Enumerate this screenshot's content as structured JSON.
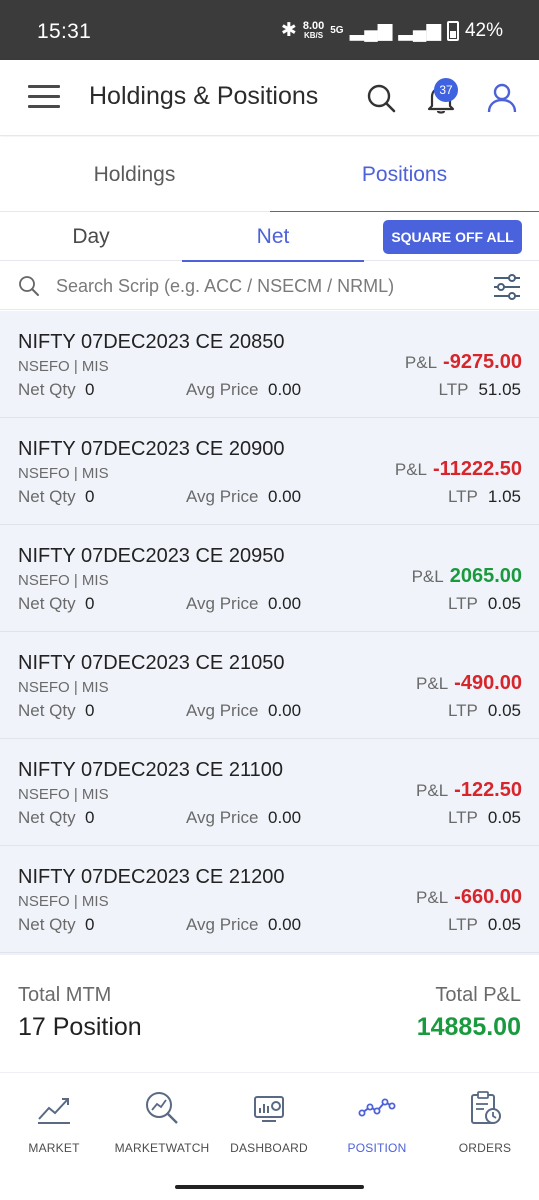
{
  "status_bar": {
    "time": "15:31",
    "speed": "8.00",
    "speed_unit": "KB/S",
    "net": "5G",
    "battery": "42%"
  },
  "header": {
    "title": "Holdings & Positions",
    "notification_count": "37"
  },
  "tabs": [
    {
      "label": "Holdings"
    },
    {
      "label": "Positions"
    }
  ],
  "subtabs": [
    {
      "label": "Day"
    },
    {
      "label": "Net"
    }
  ],
  "square_off_label": "SQUARE OFF ALL",
  "search": {
    "placeholder": "Search Scrip (e.g. ACC / NSECM / NRML)"
  },
  "labels": {
    "net_qty": "Net Qty",
    "avg_price": "Avg Price",
    "pnl": "P&L",
    "ltp": "LTP"
  },
  "positions": [
    {
      "scrip": "NIFTY 07DEC2023 CE 20850",
      "exchange": "NSEFO | MIS",
      "net_qty": "0",
      "avg_price": "0.00",
      "pnl": "-9275.00",
      "ltp": "51.05"
    },
    {
      "scrip": "NIFTY 07DEC2023 CE 20900",
      "exchange": "NSEFO | MIS",
      "net_qty": "0",
      "avg_price": "0.00",
      "pnl": "-11222.50",
      "ltp": "1.05"
    },
    {
      "scrip": "NIFTY 07DEC2023 CE 20950",
      "exchange": "NSEFO | MIS",
      "net_qty": "0",
      "avg_price": "0.00",
      "pnl": "2065.00",
      "ltp": "0.05"
    },
    {
      "scrip": "NIFTY 07DEC2023 CE 21050",
      "exchange": "NSEFO | MIS",
      "net_qty": "0",
      "avg_price": "0.00",
      "pnl": "-490.00",
      "ltp": "0.05"
    },
    {
      "scrip": "NIFTY 07DEC2023 CE 21100",
      "exchange": "NSEFO | MIS",
      "net_qty": "0",
      "avg_price": "0.00",
      "pnl": "-122.50",
      "ltp": "0.05"
    },
    {
      "scrip": "NIFTY 07DEC2023 CE 21200",
      "exchange": "NSEFO | MIS",
      "net_qty": "0",
      "avg_price": "0.00",
      "pnl": "-660.00",
      "ltp": "0.05"
    }
  ],
  "totals": {
    "mtm_label": "Total MTM",
    "mtm_value": "17 Position",
    "pnl_label": "Total P&L",
    "pnl_value": "14885.00"
  },
  "bottom_nav": [
    {
      "label": "MARKET",
      "icon": "market-chart-icon"
    },
    {
      "label": "MARKETWATCH",
      "icon": "marketwatch-icon"
    },
    {
      "label": "DASHBOARD",
      "icon": "dashboard-icon"
    },
    {
      "label": "POSITION",
      "icon": "position-icon"
    },
    {
      "label": "ORDERS",
      "icon": "orders-icon"
    }
  ],
  "colors": {
    "accent": "#4d62d8",
    "loss": "#d7262b",
    "profit": "#1a9a3e"
  }
}
